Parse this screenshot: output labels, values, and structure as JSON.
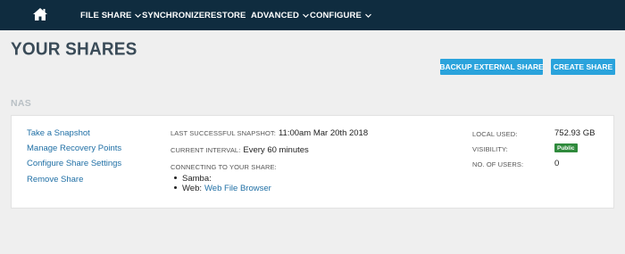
{
  "nav": {
    "home_icon": "home-icon",
    "items": [
      {
        "label": "FILE SHARE",
        "dropdown": true
      },
      {
        "label": "SYNCHRONIZE",
        "dropdown": false
      },
      {
        "label": "RESTORE",
        "dropdown": false
      },
      {
        "label": "ADVANCED",
        "dropdown": true
      },
      {
        "label": "CONFIGURE",
        "dropdown": true
      }
    ]
  },
  "page": {
    "title": "YOUR SHARES",
    "buttons": {
      "backup_external": "BACKUP EXTERNAL SHARE",
      "create_share": "CREATE SHARE"
    }
  },
  "share": {
    "name": "NAS",
    "actions": [
      "Take a Snapshot",
      "Manage Recovery Points",
      "Configure Share Settings",
      "Remove Share"
    ],
    "last_snapshot_label": "LAST SUCCESSFUL SNAPSHOT:",
    "last_snapshot_value": "11:00am Mar 20th 2018",
    "interval_label": "CURRENT INTERVAL:",
    "interval_value": "Every 60 minutes",
    "connecting_label": "CONNECTING TO YOUR SHARE:",
    "samba_label": "Samba:",
    "web_label": "Web:",
    "web_link": "Web File Browser",
    "local_used_label": "LOCAL USED:",
    "local_used_value": "752.93 GB",
    "visibility_label": "VISIBILITY:",
    "visibility_value": "Public",
    "users_label": "NO. OF USERS:",
    "users_value": "0"
  },
  "colors": {
    "topbar": "#0f2c3f",
    "accent_button": "#2aa3dc",
    "link": "#1f6fa5",
    "badge_public": "#2f8a3c"
  }
}
